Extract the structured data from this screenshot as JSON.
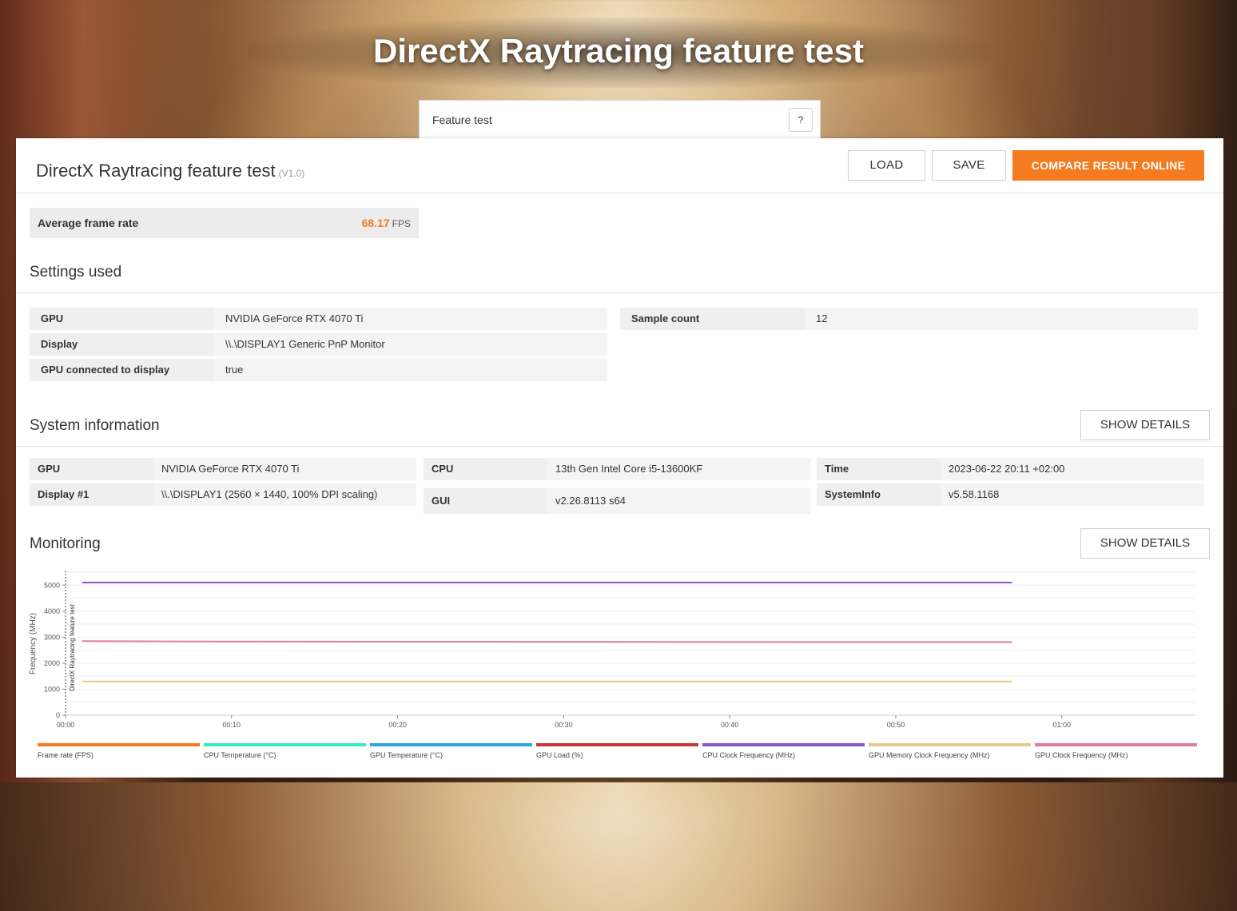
{
  "hero": {
    "title": "DirectX Raytracing feature test"
  },
  "mode_select": {
    "value": "Feature test",
    "help_label": "?"
  },
  "panel": {
    "title": "DirectX Raytracing feature test",
    "version": "(V1.0)",
    "buttons": {
      "load": "LOAD",
      "save": "SAVE",
      "compare": "COMPARE RESULT ONLINE"
    }
  },
  "average_frame_rate": {
    "label": "Average frame rate",
    "value": "68.17",
    "unit": "FPS"
  },
  "settings": {
    "title": "Settings used",
    "left": [
      {
        "key": "GPU",
        "value": "NVIDIA GeForce RTX 4070 Ti"
      },
      {
        "key": "Display",
        "value": "\\\\.\\DISPLAY1 Generic PnP Monitor"
      },
      {
        "key": "GPU connected to display",
        "value": "true"
      }
    ],
    "right": [
      {
        "key": "Sample count",
        "value": "12"
      }
    ]
  },
  "system_info": {
    "title": "System information",
    "show_details": "SHOW DETAILS",
    "col1": [
      {
        "key": "GPU",
        "value": "NVIDIA GeForce RTX 4070 Ti"
      },
      {
        "key": "Display #1",
        "value": "\\\\.\\DISPLAY1 (2560 × 1440, 100% DPI scaling)"
      }
    ],
    "col2": [
      {
        "key": "CPU",
        "value": "13th Gen Intel Core i5-13600KF"
      },
      {
        "key": "GUI",
        "value": "v2.26.8113 s64"
      }
    ],
    "col3": [
      {
        "key": "Time",
        "value": "2023-06-22 20:11 +02:00"
      },
      {
        "key": "SystemInfo",
        "value": "v5.58.1168"
      }
    ]
  },
  "monitoring": {
    "title": "Monitoring",
    "show_details": "SHOW DETAILS"
  },
  "chart_data": {
    "type": "line",
    "ylabel": "Frequency (MHz)",
    "marker_label": "DirectX Raytracing feature test",
    "ylim": [
      0,
      5500
    ],
    "xlim": [
      0,
      68
    ],
    "y_ticks": [
      0,
      1000,
      2000,
      3000,
      4000,
      5000
    ],
    "x_ticks": [
      "00:00",
      "00:10",
      "00:20",
      "00:30",
      "00:40",
      "00:50",
      "01:00"
    ],
    "x_tick_values": [
      0,
      10,
      20,
      30,
      40,
      50,
      60
    ],
    "grid": true,
    "series": [
      {
        "name": "CPU Clock Frequency (MHz)",
        "color": "#8e55c7",
        "x": [
          1,
          57
        ],
        "values": [
          5100,
          5100
        ]
      },
      {
        "name": "GPU Clock Frequency (MHz)",
        "color": "#e07aa0",
        "x": [
          1,
          8,
          47,
          57
        ],
        "values": [
          2850,
          2835,
          2810,
          2810
        ]
      },
      {
        "name": "GPU Memory Clock Frequency (MHz)",
        "color": "#e8c98c",
        "x": [
          1,
          57
        ],
        "values": [
          1300,
          1300
        ]
      }
    ],
    "legend": [
      {
        "name": "Frame rate (FPS)",
        "color": "#f47b20"
      },
      {
        "name": "CPU Temperature (°C)",
        "color": "#35e8c8"
      },
      {
        "name": "GPU Temperature (°C)",
        "color": "#27a7e8"
      },
      {
        "name": "GPU Load (%)",
        "color": "#cc3333"
      },
      {
        "name": "CPU Clock Frequency (MHz)",
        "color": "#8e55c7"
      },
      {
        "name": "GPU Memory Clock Frequency (MHz)",
        "color": "#e8c98c"
      },
      {
        "name": "GPU Clock Frequency (MHz)",
        "color": "#e07aa0"
      }
    ]
  }
}
